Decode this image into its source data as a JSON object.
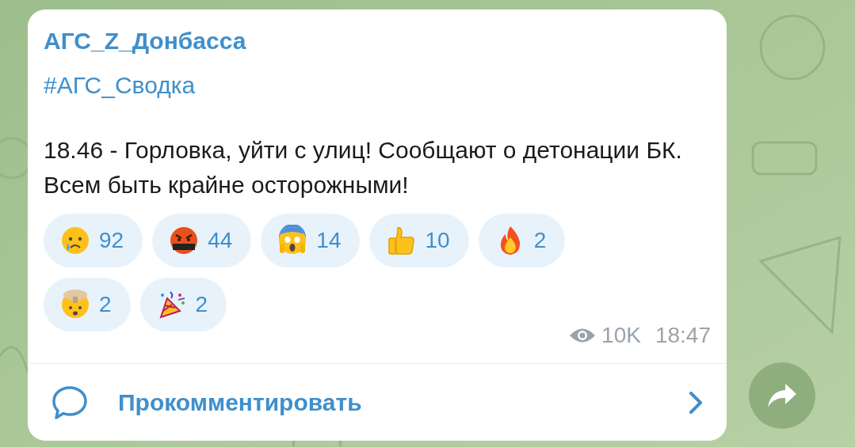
{
  "channel_name": "АГС_Z_Донбасса",
  "hashtag": "#АГС_Сводка",
  "message": "18.46 - Горловка, уйти с улиц! Сообщают о детонации БК. Всем быть крайне осторожными!",
  "reactions": [
    {
      "kind": "crying",
      "count": "92"
    },
    {
      "kind": "cursing",
      "count": "44"
    },
    {
      "kind": "screaming",
      "count": "14"
    },
    {
      "kind": "thumbs-up",
      "count": "10"
    },
    {
      "kind": "fire",
      "count": "2"
    },
    {
      "kind": "exploding-head",
      "count": "2"
    },
    {
      "kind": "party-popper",
      "count": "2"
    }
  ],
  "views": "10K",
  "time": "18:47",
  "comment_button": "Прокомментировать"
}
